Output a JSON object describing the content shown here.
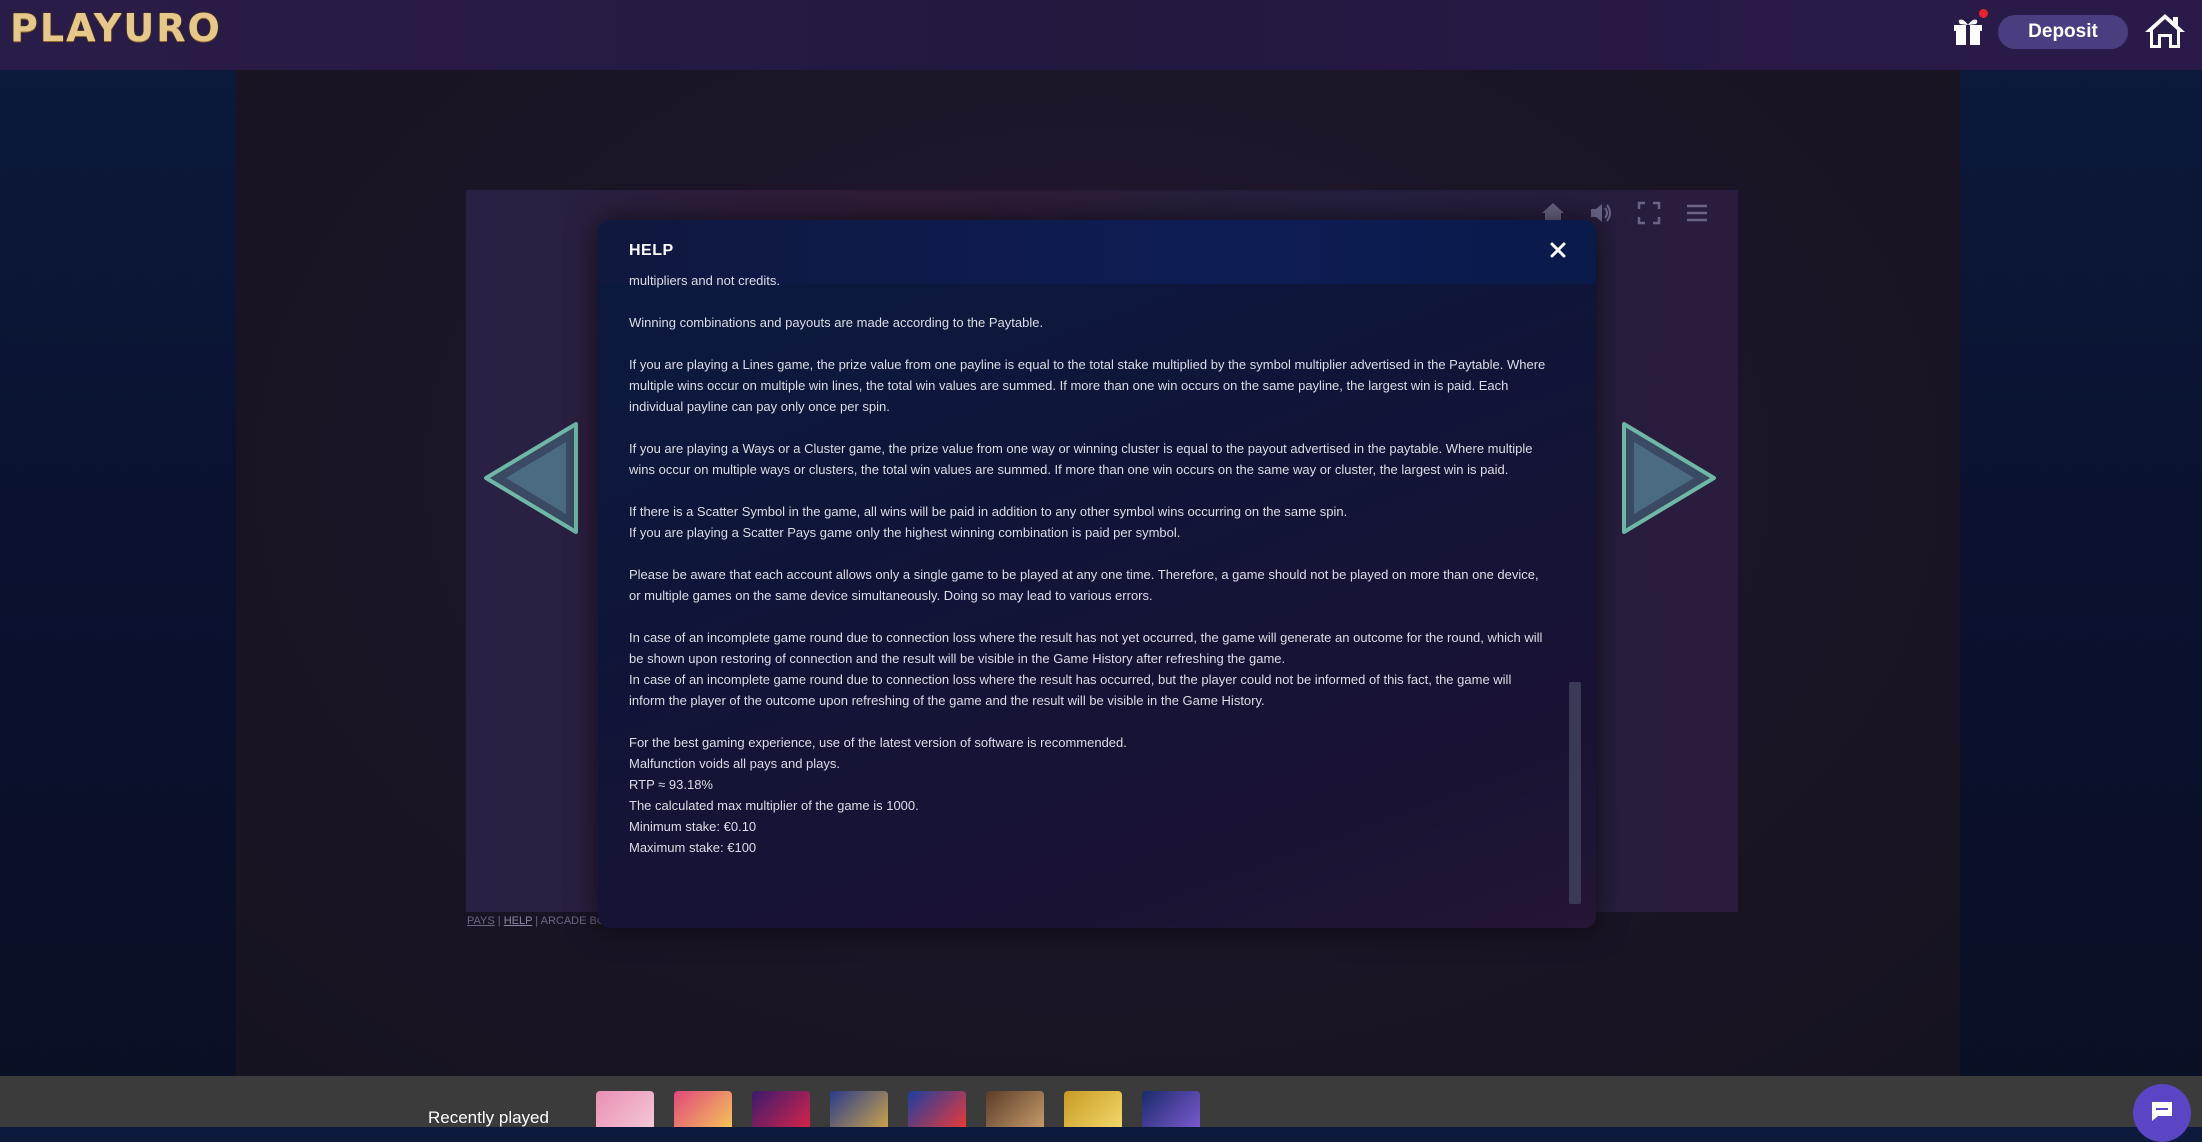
{
  "header": {
    "logo_text": "PLAYURO",
    "deposit_label": "Deposit",
    "gift_icon": "gift-icon",
    "home_icon": "home-icon"
  },
  "game": {
    "top_icons": [
      "home-icon",
      "sound-icon",
      "fullscreen-icon",
      "menu-icon"
    ],
    "footer_links": {
      "pays": "PAYS",
      "help": "HELP",
      "arcade": "ARCADE BO..."
    }
  },
  "modal": {
    "title": "HELP",
    "paragraphs": [
      [
        "multipliers and not credits."
      ],
      [
        "Winning combinations and payouts are made according to the Paytable."
      ],
      [
        "If you are playing a Lines game, the prize value from one payline is equal to the total stake multiplied by the symbol multiplier advertised in the Paytable. Where multiple wins occur on multiple win lines, the total win values are summed. If more than one win occurs on the same payline, the largest win is paid. Each individual payline can pay only once per spin."
      ],
      [
        "If you are playing a Ways or a Cluster game, the prize value from one way or winning cluster is equal to the payout advertised in the paytable. Where multiple wins occur on multiple ways or clusters, the total win values are summed. If more than one win occurs on the same way or cluster, the largest win is paid."
      ],
      [
        "If there is a Scatter Symbol in the game, all wins will be paid in addition to any other symbol wins occurring on the same spin.",
        "If you are playing a Scatter Pays game only the highest winning combination is paid per symbol."
      ],
      [
        "Please be aware that each account allows only a single game to be played at any one time. Therefore, a game should not be played on more than one device, or multiple games on the same device simultaneously. Doing so may lead to various errors."
      ],
      [
        "In case of an incomplete game round due to connection loss where the result has not yet occurred, the game will generate an outcome for the round, which will be shown upon restoring of connection and the result will be visible in the Game History after refreshing the game.",
        "In case of an incomplete game round due to connection loss where the result has occurred, but the player could not be informed of this fact, the game will inform the player of the outcome upon refreshing of the game and the result will be visible in the Game History."
      ],
      [
        "For the best gaming experience, use of the latest version of software is recommended.",
        "Malfunction voids all pays and plays.",
        "RTP ≈ 93.18%",
        "The calculated max multiplier of the game is 1000.",
        "Minimum stake: €0.10",
        "Maximum stake: €100"
      ]
    ]
  },
  "recently_played": {
    "label": "Recently played",
    "thumbs": [
      {
        "name": "recent-game-1",
        "colors": [
          "#e98fb4",
          "#f4c6d8"
        ]
      },
      {
        "name": "recent-game-2",
        "colors": [
          "#e0487c",
          "#f5c25a"
        ]
      },
      {
        "name": "recent-game-3",
        "colors": [
          "#3b1a6e",
          "#d2244a"
        ]
      },
      {
        "name": "recent-game-4",
        "colors": [
          "#2a3b8a",
          "#c8a24c"
        ]
      },
      {
        "name": "recent-game-5",
        "colors": [
          "#1a3fa0",
          "#e83a3a"
        ]
      },
      {
        "name": "recent-game-6",
        "colors": [
          "#5a3c28",
          "#c59a6a"
        ]
      },
      {
        "name": "recent-game-7",
        "colors": [
          "#c89a24",
          "#f2d86a"
        ]
      },
      {
        "name": "recent-game-8",
        "colors": [
          "#1b2a6a",
          "#7a5ad0"
        ]
      }
    ]
  },
  "colors": {
    "deposit_bg": "#4b3d80",
    "chat_bg": "#5c45c5",
    "notification_dot": "#e8232f"
  }
}
